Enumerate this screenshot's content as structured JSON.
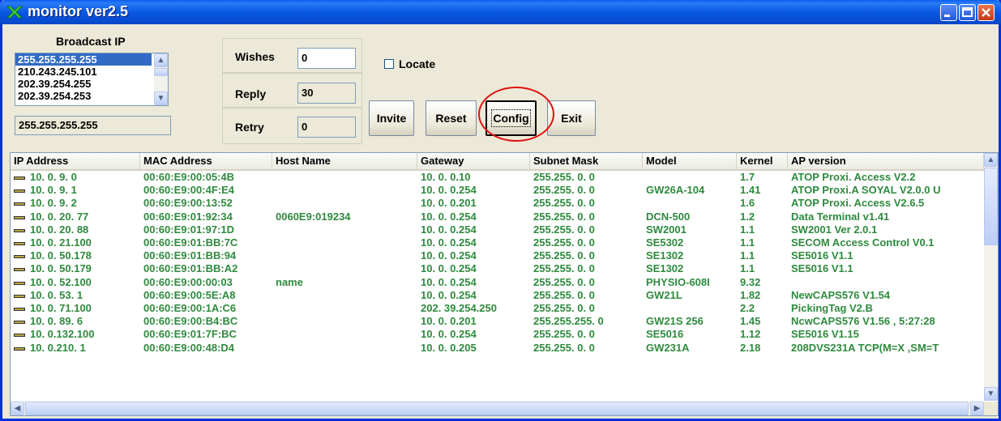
{
  "window": {
    "title": "monitor ver2.5"
  },
  "broadcast": {
    "label": "Broadcast IP",
    "items": [
      "255.255.255.255",
      "210.243.245.101",
      "202.39.254.255",
      "202.39.254.253"
    ],
    "current": "255.255.255.255"
  },
  "fields": {
    "wishes_label": "Wishes",
    "wishes_value": "0",
    "reply_label": "Reply",
    "reply_value": "30",
    "retry_label": "Retry",
    "retry_value": "0"
  },
  "locate_label": "Locate",
  "buttons": {
    "invite": "Invite",
    "reset": "Reset",
    "config": "Config",
    "exit": "Exit"
  },
  "columns": [
    "IP Address",
    "MAC Address",
    "Host Name",
    "Gateway",
    "Subnet Mask",
    "Model",
    "Kernel",
    "AP version"
  ],
  "rows": [
    [
      "10. 0. 9. 0",
      "00:60:E9:00:05:4B",
      "",
      "10. 0. 0.10",
      "255.255. 0. 0",
      "",
      "1.7",
      "ATOP Proxi. Access V2.2"
    ],
    [
      "10. 0. 9. 1",
      "00:60:E9:00:4F:E4",
      "",
      "10. 0. 0.254",
      "255.255. 0. 0",
      "GW26A-104",
      "1.41",
      "ATOP Proxi.A SOYAL V2.0.0 U"
    ],
    [
      "10. 0. 9. 2",
      "00:60:E9:00:13:52",
      "",
      "10. 0. 0.201",
      "255.255. 0. 0",
      "",
      "1.6",
      "ATOP Proxi. Access V2.6.5"
    ],
    [
      "10. 0. 20. 77",
      "00:60:E9:01:92:34",
      "0060E9:019234",
      "10. 0. 0.254",
      "255.255. 0. 0",
      "DCN-500",
      "1.2",
      "Data Terminal  v1.41"
    ],
    [
      "10. 0. 20. 88",
      "00:60:E9:01:97:1D",
      "",
      "10. 0. 0.254",
      "255.255. 0. 0",
      "SW2001",
      "1.1",
      "SW2001 Ver 2.0.1"
    ],
    [
      "10. 0. 21.100",
      "00:60:E9:01:BB:7C",
      "",
      "10. 0. 0.254",
      "255.255. 0. 0",
      "SE5302",
      "1.1",
      "SECOM Access Control V0.1"
    ],
    [
      "10. 0. 50.178",
      "00:60:E9:01:BB:94",
      "",
      "10. 0. 0.254",
      "255.255. 0. 0",
      "SE1302",
      "1.1",
      "SE5016 V1.1"
    ],
    [
      "10. 0. 50.179",
      "00:60:E9:01:BB:A2",
      "",
      "10. 0. 0.254",
      "255.255. 0. 0",
      "SE1302",
      "1.1",
      "SE5016 V1.1"
    ],
    [
      "10. 0. 52.100",
      "00:60:E9:00:00:03",
      "name",
      "10. 0. 0.254",
      "255.255. 0. 0",
      "PHYSIO-608I",
      "9.32",
      ""
    ],
    [
      "10. 0. 53. 1",
      "00:60:E9:00:5E:A8",
      "",
      "10. 0. 0.254",
      "255.255. 0. 0",
      "GW21L",
      "1.82",
      "NewCAPS576 V1.54"
    ],
    [
      "10. 0. 71.100",
      "00:60:E9:00:1A:C6",
      "",
      "202. 39.254.250",
      "255.255. 0. 0",
      "",
      "2.2",
      "PickingTag V2.B"
    ],
    [
      "10. 0. 89. 6",
      "00:60:E9:00:B4:BC",
      "",
      "10. 0. 0.201",
      "255.255.255. 0",
      "GW21S 256",
      "1.45",
      "NcwCAPS576 V1.56 , 5:27:28"
    ],
    [
      "10. 0.132.100",
      "00:60:E9:01:7F:BC",
      "",
      "10. 0. 0.254",
      "255.255. 0. 0",
      "SE5016",
      "1.12",
      "SE5016 V1.15"
    ],
    [
      "10. 0.210. 1",
      "00:60:E9:00:48:D4",
      "",
      "10. 0. 0.205",
      "255.255. 0. 0",
      "GW231A",
      "2.18",
      "208DVS231A TCP(M=X ,SM=T"
    ]
  ],
  "colors": {
    "titlebar": "#0a58e4",
    "row_text": "#2e8a3e",
    "highlight_circle": "#e01010"
  }
}
